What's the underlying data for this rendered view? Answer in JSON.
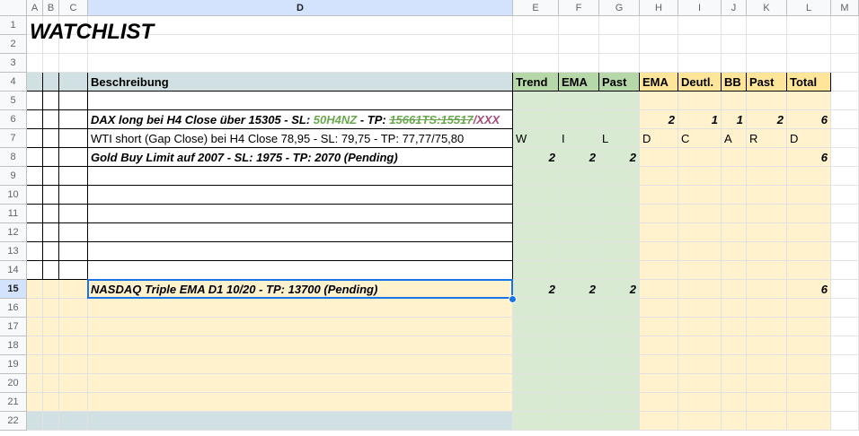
{
  "columns": [
    "A",
    "B",
    "C",
    "D",
    "E",
    "F",
    "G",
    "H",
    "I",
    "J",
    "K",
    "L",
    "M"
  ],
  "rows": [
    "1",
    "2",
    "3",
    "4",
    "5",
    "6",
    "7",
    "8",
    "9",
    "10",
    "11",
    "12",
    "13",
    "14",
    "15",
    "16",
    "17",
    "18",
    "19",
    "20",
    "21",
    "22"
  ],
  "title": "WATCHLIST",
  "header": {
    "beschreibung": "Beschreibung",
    "trend": "Trend",
    "ema1": "EMA",
    "past1": "Past",
    "ema2": "EMA",
    "deutl": "Deutl.",
    "bb": "BB",
    "past2": "Past",
    "total": "Total"
  },
  "row6": {
    "desc_part1": "DAX long bei H4 Close über 15305 - SL: ",
    "desc_sl": "50H4NZ",
    "desc_part2": " - TP: ",
    "desc_tp_struck": "15661TS:15517",
    "desc_tp_rest": "/XXX",
    "ema2": "2",
    "deutl": "1",
    "bb": "1",
    "past2": "2",
    "total": "6"
  },
  "row7": {
    "desc": "WTI short (Gap Close) bei H4 Close 78,95 - SL: 79,75 - TP: 77,77/75,80",
    "trend": "W",
    "ema1": "I",
    "past1": "L",
    "ema2": "D",
    "deutl": "C",
    "bb": "A",
    "past2": "R",
    "total": "D"
  },
  "row8": {
    "desc": "Gold Buy Limit auf 2007 - SL: 1975 - TP: 2070 (Pending)",
    "trend": "2",
    "ema1": "2",
    "past1": "2",
    "total": "6"
  },
  "row15": {
    "desc": "NASDAQ Triple EMA D1 10/20 - TP: 13700 (Pending)",
    "trend": "2",
    "ema1": "2",
    "past1": "2",
    "total": "6"
  },
  "colors": {
    "green_fill": "#d9ead3",
    "yellow_fill": "#fff2cc",
    "blue_header": "#d0e0e3",
    "green_header": "#b6d7a8",
    "yellow_header": "#ffe599",
    "selection": "#1a73e8"
  }
}
